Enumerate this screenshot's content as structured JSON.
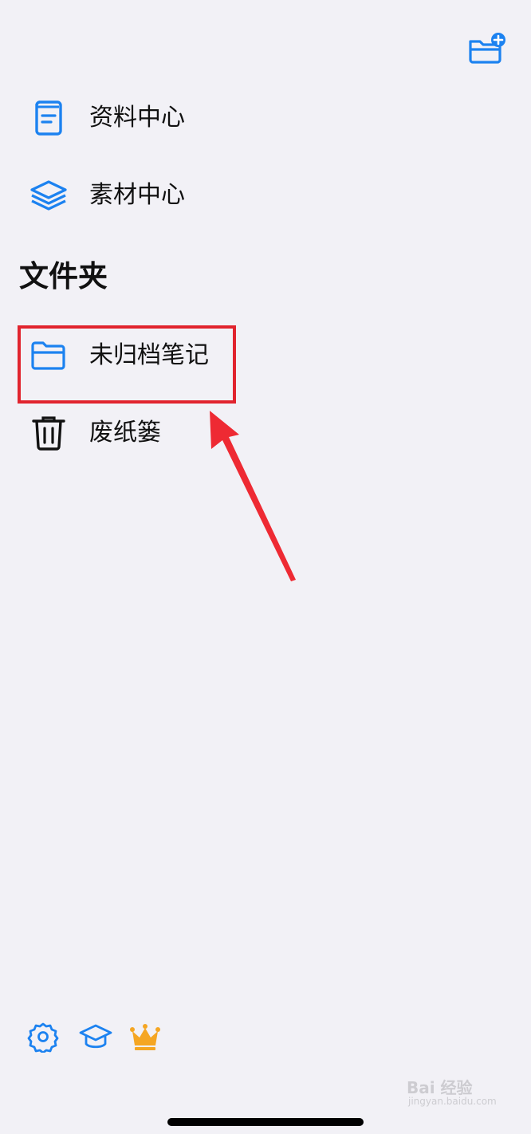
{
  "colors": {
    "background": "#f2f1f6",
    "accent": "#1c82f0",
    "text": "#111111",
    "highlight": "#e1242e",
    "crown": "#f5a623"
  },
  "header": {
    "new_folder_icon": "folder-plus-icon"
  },
  "menu": {
    "items": [
      {
        "label": "资料中心",
        "icon": "document-book-icon"
      },
      {
        "label": "素材中心",
        "icon": "layers-icon"
      }
    ]
  },
  "folders": {
    "title": "文件夹",
    "items": [
      {
        "label": "未归档笔记",
        "icon": "folder-icon",
        "highlighted": true
      },
      {
        "label": "废纸篓",
        "icon": "trash-icon"
      }
    ]
  },
  "bottom_bar": {
    "icons": [
      "settings-gear-icon",
      "graduation-cap-icon",
      "crown-icon"
    ]
  },
  "annotation": {
    "type": "red-arrow-pointing-to-highlighted-folder"
  },
  "watermark": {
    "line1": "Bai 经验",
    "line2": "jingyan.baidu.com"
  }
}
